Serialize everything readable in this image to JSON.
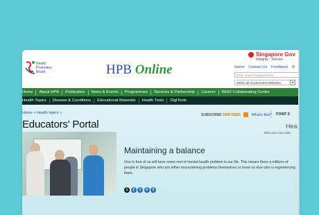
{
  "header": {
    "logo_lines": [
      "Health",
      "Promotion",
      "Board"
    ],
    "site_title_hpb": "HPB",
    "site_title_online": "Online",
    "gov_name": "Singapore Gov",
    "gov_tagline": "Integrity · Service ·",
    "top_links": [
      "Home",
      "Contact Us",
      "Feedback",
      "Si"
    ],
    "search_placeholder": "Enter search keyword here",
    "search_scope": "Within all Government Websites",
    "search_go": "▾"
  },
  "nav_primary": [
    "Home",
    "About HPB",
    "Publication",
    "News & Events",
    "Programmes",
    "Services & Partnership",
    "Careers",
    "WHO Collaborating Centre"
  ],
  "nav_secondary": [
    "Health Topics",
    "Disease & Conditions",
    "Educational Materials",
    "Health Tools",
    "DigiTools"
  ],
  "breadcrumb": "Home > Health topics >",
  "page_title": "Educators' Portal",
  "rss": {
    "label_prefix": "SUBSCRIBE",
    "label_highlight": "OUR FEED",
    "whats_this": "What's this?"
  },
  "point_label": "POINT S",
  "side_heading": "Hea",
  "side_phone": "1800 223 1313 (Mo",
  "feature": {
    "title": "Maintaining a balance",
    "text": "One in four of us will have some sort of mental health problem in our life. This means there a millions of people in Singapore who are either encountering problems themselves or know so else who is experiencing them.",
    "slides": [
      "1",
      "2",
      "3",
      "4",
      "5"
    ]
  },
  "colors": {
    "background": "#5ccbd6",
    "nav_primary": "#2c8236",
    "nav_secondary": "#0d2f2b",
    "gov_red": "#d2232a",
    "link_blue": "#2a4ea0"
  }
}
